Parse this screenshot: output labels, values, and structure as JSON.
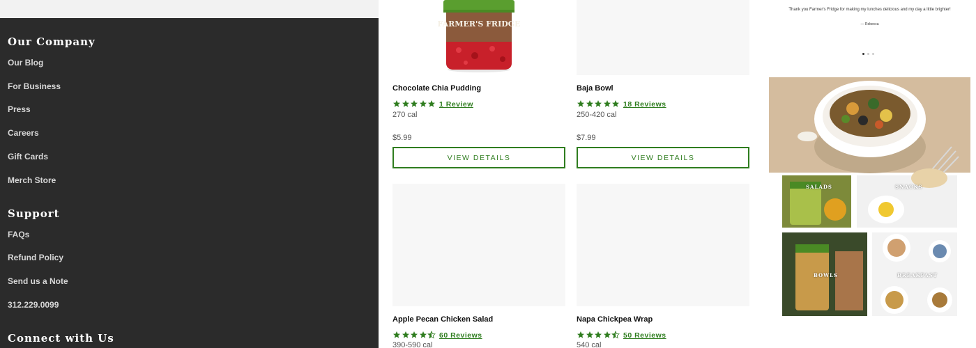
{
  "footer": {
    "company_heading": "Our Company",
    "company_links": [
      "Our Blog",
      "For Business",
      "Press",
      "Careers",
      "Gift Cards",
      "Merch Store"
    ],
    "support_heading": "Support",
    "support_links": [
      "FAQs",
      "Refund Policy",
      "Send us a Note",
      "312.229.0099"
    ],
    "connect_heading": "Connect with Us"
  },
  "products": [
    {
      "name": "Chocolate Chia Pudding",
      "rating": 5,
      "reviews": "1 Review",
      "cal": "270 cal",
      "price": "$5.99",
      "cta": "View Details",
      "jar_label": "FARMER'S FRIDGE"
    },
    {
      "name": "Baja Bowl",
      "rating": 5,
      "reviews": "18 Reviews",
      "cal": "250-420 cal",
      "price": "$7.99",
      "cta": "View Details"
    },
    {
      "name": "Apple Pecan Chicken Salad",
      "rating": 4.5,
      "reviews": "60 Reviews",
      "cal": "390-590 cal"
    },
    {
      "name": "Napa Chickpea Wrap",
      "rating": 4.5,
      "reviews": "50 Reviews",
      "cal": "540 cal"
    }
  ],
  "testimonial": {
    "quote": "Thank you Farmer's Fridge for making my lunches delicious and my day a little brighter!",
    "author": "— Rebecca",
    "slides": 3,
    "active_slide": 1
  },
  "categories": {
    "salads": "SALADS",
    "snacks": "SNACKS",
    "bowls": "BOWLS",
    "breakfast": "BREAKFAST"
  },
  "colors": {
    "footer_bg": "#2b2b2b",
    "accent_green": "#2f7d1f"
  },
  "icons": {
    "star": "star-icon",
    "half_star": "half-star-icon"
  }
}
